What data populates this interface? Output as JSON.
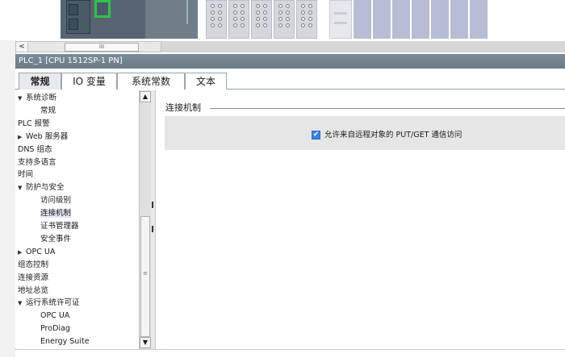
{
  "device_view": {
    "hscroll_left_arrow": "<",
    "hscroll_grip": "III"
  },
  "properties": {
    "title": "PLC_1 [CPU 1512SP-1 PN]",
    "tabs": [
      {
        "label": "常规",
        "active": true
      },
      {
        "label": "IO 变量",
        "active": false
      },
      {
        "label": "系统常数",
        "active": false
      },
      {
        "label": "文本",
        "active": false
      }
    ]
  },
  "nav": {
    "items": [
      {
        "label": "系统诊断",
        "arrow": "▼",
        "indent": 0
      },
      {
        "label": "常规",
        "arrow": "",
        "indent": 2
      },
      {
        "label": "PLC 报警",
        "arrow": "",
        "indent": 0
      },
      {
        "label": "Web 服务器",
        "arrow": "▶",
        "indent": 0
      },
      {
        "label": "DNS 组态",
        "arrow": "",
        "indent": 0
      },
      {
        "label": "支持多语言",
        "arrow": "",
        "indent": 0
      },
      {
        "label": "时间",
        "arrow": "",
        "indent": 0
      },
      {
        "label": "防护与安全",
        "arrow": "▼",
        "indent": 0
      },
      {
        "label": "访问级别",
        "arrow": "",
        "indent": 2
      },
      {
        "label": "连接机制",
        "arrow": "",
        "indent": 2,
        "selected": true
      },
      {
        "label": "证书管理器",
        "arrow": "",
        "indent": 2
      },
      {
        "label": "安全事件",
        "arrow": "",
        "indent": 2
      },
      {
        "label": "OPC UA",
        "arrow": "▶",
        "indent": 0
      },
      {
        "label": "组态控制",
        "arrow": "",
        "indent": 0
      },
      {
        "label": "连接资源",
        "arrow": "",
        "indent": 0
      },
      {
        "label": "地址总览",
        "arrow": "",
        "indent": 0
      },
      {
        "label": "运行系统许可证",
        "arrow": "▼",
        "indent": 0
      },
      {
        "label": "OPC UA",
        "arrow": "",
        "indent": 2
      },
      {
        "label": "ProDiag",
        "arrow": "",
        "indent": 2
      },
      {
        "label": "Energy Suite",
        "arrow": "",
        "indent": 2
      }
    ],
    "scroll_up": "▲",
    "scroll_down": "▼",
    "scroll_grip": "≡"
  },
  "content": {
    "section_title": "连接机制",
    "checkbox_label": "允许来自远程对象的 PUT/GET 通信访问",
    "checkbox_checked": true,
    "checkbox_mark": "✔"
  }
}
